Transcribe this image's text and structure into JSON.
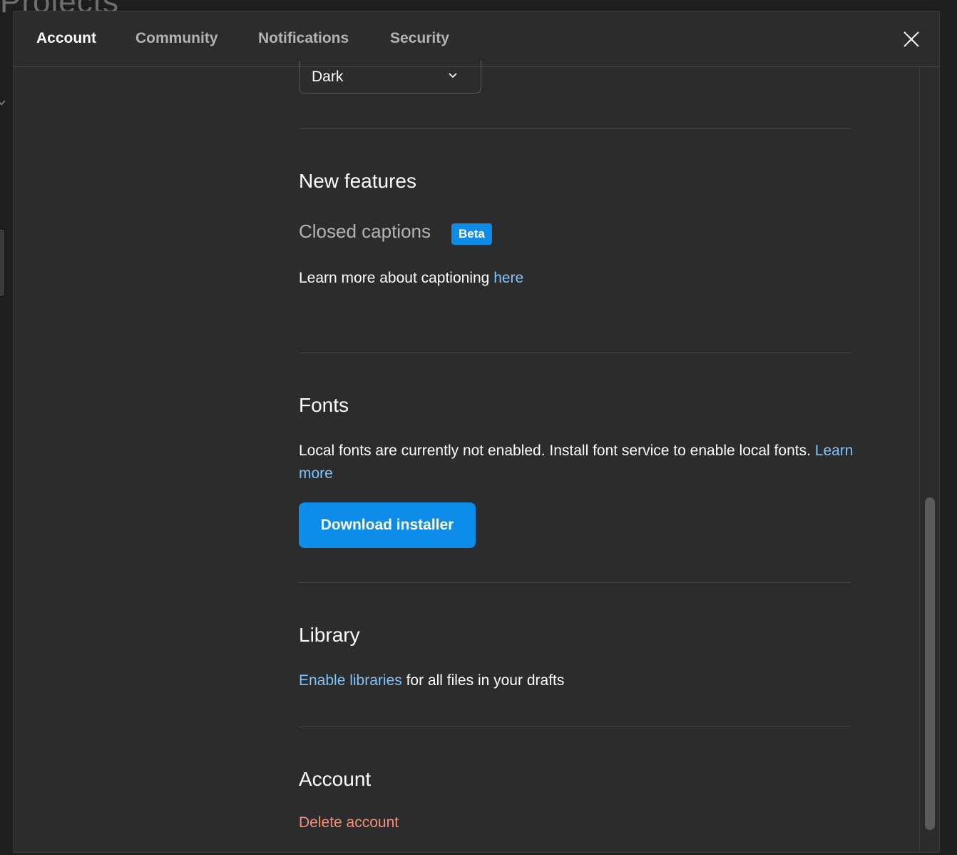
{
  "background": {
    "title": "Projects"
  },
  "tabs": [
    {
      "label": "Account",
      "active": true
    },
    {
      "label": "Community",
      "active": false
    },
    {
      "label": "Notifications",
      "active": false
    },
    {
      "label": "Security",
      "active": false
    }
  ],
  "theme": {
    "selected": "Dark"
  },
  "new_features": {
    "heading": "New features",
    "closed_captions_label": "Closed captions",
    "badge": "Beta",
    "learn_text": "Learn more about captioning ",
    "learn_link": "here"
  },
  "fonts": {
    "heading": "Fonts",
    "description": "Local fonts are currently not enabled. Install font service to enable local fonts. ",
    "learn_link": "Learn more",
    "download_button": "Download installer"
  },
  "library": {
    "heading": "Library",
    "enable_link": "Enable libraries",
    "rest_text": " for all files in your drafts"
  },
  "account": {
    "heading": "Account",
    "delete_link": "Delete account"
  },
  "colors": {
    "accent": "#0d8ce9",
    "link": "#7cc4fa",
    "danger": "#f0907d",
    "background": "#2c2c2c"
  }
}
